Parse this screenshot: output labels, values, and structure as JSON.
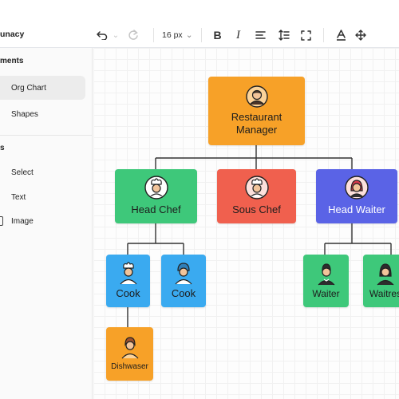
{
  "app": {
    "title": "unacy"
  },
  "toolbar": {
    "font_size": "16 px",
    "font_size_chevron": "⌄",
    "undo_chevron": "⌄",
    "bold": "B",
    "italic": "I"
  },
  "sidebar": {
    "section1": "ments",
    "section2": "s",
    "items": [
      {
        "label": "Org Chart"
      },
      {
        "label": "Shapes"
      },
      {
        "label": "Select"
      },
      {
        "label": "Text"
      },
      {
        "label": "Image"
      }
    ]
  },
  "chart": {
    "nodes": {
      "manager": {
        "line1": "Restaurant",
        "line2": "Manager",
        "color": "#f7a128"
      },
      "head_chef": {
        "label": "Head Chef",
        "color": "#3ec87a"
      },
      "sous_chef": {
        "label": "Sous Chef",
        "color": "#f0604e"
      },
      "head_waiter": {
        "label": "Head Waiter",
        "color": "#5a63e6"
      },
      "cook1": {
        "label": "Cook",
        "color": "#3aaaf0"
      },
      "cook2": {
        "label": "Cook",
        "color": "#3aaaf0"
      },
      "waiter": {
        "label": "Waiter",
        "color": "#3ec87a"
      },
      "waitress": {
        "label": "Waitres",
        "color": "#3ec87a"
      },
      "dishwasher": {
        "label": "Dishwaser",
        "color": "#f7a128"
      }
    }
  }
}
